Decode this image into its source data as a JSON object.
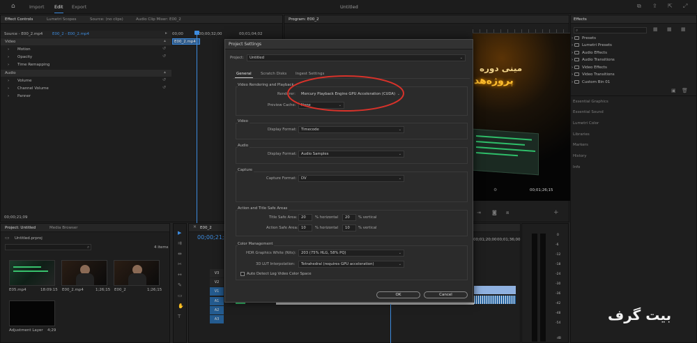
{
  "topbar": {
    "tabs": [
      "Import",
      "Edit",
      "Export"
    ],
    "active_tab": "Edit",
    "doc_title": "Untitled"
  },
  "effect_controls": {
    "tabs": [
      "Effect Controls",
      "Lumetri Scopes",
      "Source: (no clips)",
      "Audio Clip Mixer: E00_2"
    ],
    "source_label": "Source - E00_2.mp4",
    "clip_label": "E00_2 - E00_2.mp4",
    "ruler": [
      "00;00",
      "00;00;32;00",
      "00;01;04;02"
    ],
    "clip_chip": "E00_2.mp4",
    "sections": {
      "video": "Video",
      "audio": "Audio"
    },
    "video_props": [
      "Motion",
      "Opacity",
      "Time Remapping"
    ],
    "audio_props": [
      "Volume",
      "Channel Volume",
      "Panner"
    ],
    "timecode": "00;00;21;09"
  },
  "program": {
    "title": "Program: E00_2",
    "overlay_line1": "مینی دوره",
    "overlay_line2": "پروژه‌هد",
    "timecode": "00;01;26;15"
  },
  "effects_panel": {
    "title": "Effects",
    "items": [
      "Presets",
      "Lumetri Presets",
      "Audio Effects",
      "Audio Transitions",
      "Video Effects",
      "Video Transitions",
      "Custom Bin 01"
    ],
    "collapsed_panels": [
      "Essential Graphics",
      "Essential Sound",
      "Lumetri Color",
      "Libraries",
      "Markers",
      "History",
      "Info"
    ]
  },
  "project_panel": {
    "tabs": [
      "Project: Untitled",
      "Media Browser"
    ],
    "file": "Untitled.prproj",
    "count": "4 items",
    "items": [
      {
        "name": "E05.mp4",
        "dur": "18:09:15"
      },
      {
        "name": "E00_2.mp4",
        "dur": "1;26;15"
      },
      {
        "name": "E00_2",
        "dur": "1;26;15"
      },
      {
        "name": "Adjustment Layer",
        "dur": "4;29"
      }
    ]
  },
  "timeline": {
    "tab": "E00_2",
    "timecode": "00;00;21;0",
    "tracks": [
      "V3",
      "V2",
      "V1",
      "A1",
      "A2",
      "A3"
    ],
    "ruler": [
      "00;01;20;00",
      "00;01;36;00"
    ],
    "meter_scale": [
      "0",
      "-6",
      "-12",
      "-18",
      "-24",
      "-30",
      "-36",
      "-42",
      "-48",
      "-54",
      "dB"
    ]
  },
  "dialog": {
    "title": "Project Settings",
    "project_label": "Project:",
    "project_value": "Untitled",
    "tabs": [
      "General",
      "Scratch Disks",
      "Ingest Settings"
    ],
    "active_tab": "General",
    "video_rendering": {
      "heading": "Video Rendering and Playback",
      "renderer_label": "Renderer:",
      "renderer_value": "Mercury Playback Engine GPU Acceleration (CUDA)",
      "preview_label": "Preview Cache:",
      "preview_value": "None"
    },
    "video": {
      "heading": "Video",
      "display_label": "Display Format:",
      "display_value": "Timecode"
    },
    "audio": {
      "heading": "Audio",
      "display_label": "Display Format:",
      "display_value": "Audio Samples"
    },
    "capture": {
      "heading": "Capture",
      "format_label": "Capture Format:",
      "format_value": "DV"
    },
    "safe_areas": {
      "heading": "Action and Title Safe Areas",
      "title_label": "Title Safe Area:",
      "title_h": "20",
      "title_v": "20",
      "action_label": "Action Safe Area:",
      "action_h": "10",
      "action_v": "10",
      "horizontal": "% horizontal",
      "vertical": "% vertical"
    },
    "color": {
      "heading": "Color Management",
      "hdr_label": "HDR Graphics White (Nits):",
      "hdr_value": "203 (75% HLG, 58% PQ)",
      "lut_label": "3D LUT Interpolation:",
      "lut_value": "Tetrahedral (requires GPU acceleration)",
      "auto_detect": "Auto Detect Log Video Color Space"
    },
    "ok": "OK",
    "cancel": "Cancel"
  },
  "watermark": "بیت گرف",
  "colors": {
    "highlight_circle": "#d8322a",
    "accent": "#3d8ce0"
  }
}
